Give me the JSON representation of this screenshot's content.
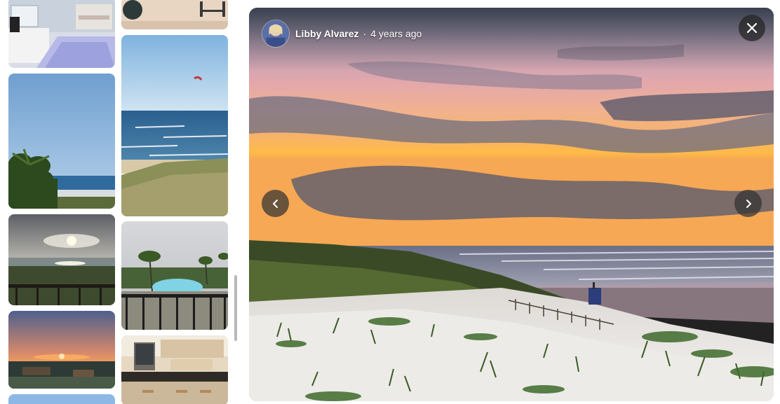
{
  "viewer": {
    "author_name": "Libby Alvarez",
    "separator": "·",
    "timestamp": "4 years ago",
    "close_label": "Close",
    "prev_label": "Previous photo",
    "next_label": "Next photo"
  },
  "icons": {
    "close": "close-icon",
    "prev": "chevron-left-icon",
    "next": "chevron-right-icon"
  },
  "gallery": {
    "thumbnails": [
      {
        "id": "bedroom",
        "subject": "bedroom interior"
      },
      {
        "id": "balcony-chair",
        "subject": "balcony with chair"
      },
      {
        "id": "sky-palm",
        "subject": "sky and palm tree"
      },
      {
        "id": "ocean-kite",
        "subject": "ocean with kite"
      },
      {
        "id": "sunset-balcony",
        "subject": "sunset from balcony"
      },
      {
        "id": "pool",
        "subject": "pool with palm trees"
      },
      {
        "id": "sunset-town",
        "subject": "sunset over town"
      },
      {
        "id": "kitchen",
        "subject": "kitchen interior"
      },
      {
        "id": "sky-partial",
        "subject": "sky"
      }
    ]
  },
  "colors": {
    "button_bg": "#2e2e2e",
    "icon_fg": "#ffffff",
    "page_bg": "#ffffff"
  }
}
